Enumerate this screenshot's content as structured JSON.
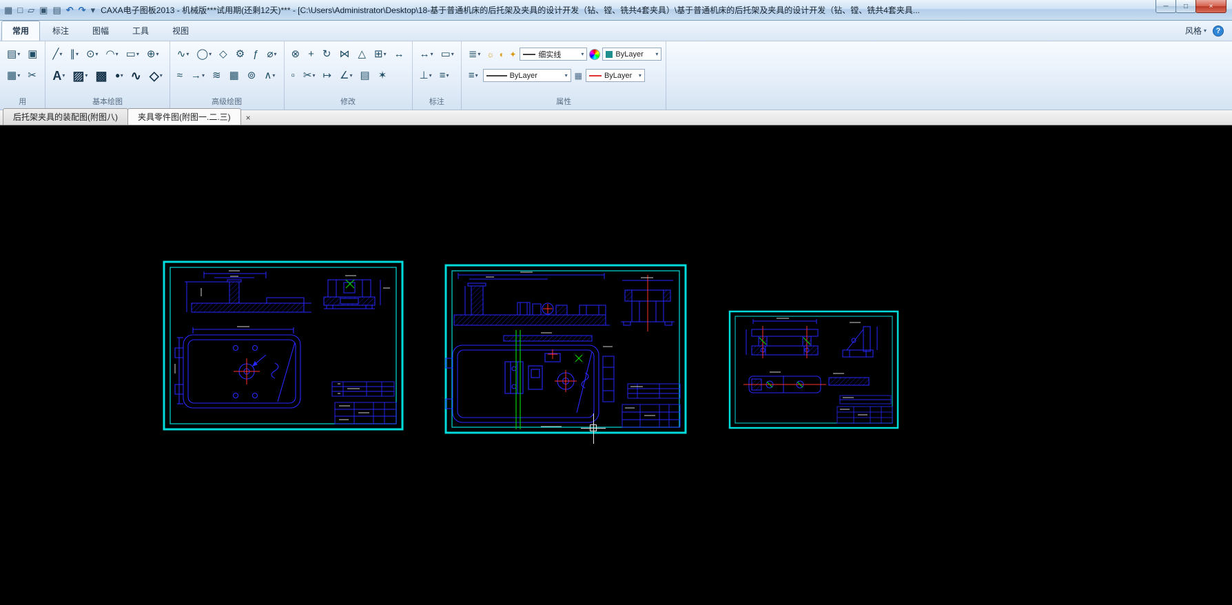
{
  "window": {
    "title": "CAXA电子图板2013 - 机械版***试用期(还剩12天)*** - [C:\\Users\\Administrator\\Desktop\\18-基于普通机床的后托架及夹具的设计开发（钻、镗、铣共4套夹具）\\基于普通机床的后托架及夹具的设计开发（钻、镗、铣共4套夹具...",
    "controls": [
      {
        "name": "minimize-button",
        "glyph": "─"
      },
      {
        "name": "maximize-button",
        "glyph": "□"
      },
      {
        "name": "close-button",
        "glyph": "×"
      }
    ]
  },
  "quick_access": [
    {
      "name": "app-icon",
      "glyph": "▦"
    },
    {
      "name": "new-file-icon",
      "glyph": "□"
    },
    {
      "name": "open-file-icon",
      "glyph": "▱"
    },
    {
      "name": "save-icon",
      "glyph": "▣"
    },
    {
      "name": "print-icon",
      "glyph": "▤"
    },
    {
      "name": "undo-icon",
      "glyph": "↶"
    },
    {
      "name": "redo-icon",
      "glyph": "↷"
    },
    {
      "name": "qat-dropdown-icon",
      "glyph": "▾"
    }
  ],
  "ribbon": {
    "tabs": [
      {
        "label": "常用",
        "active": true
      },
      {
        "label": "标注",
        "active": false
      },
      {
        "label": "图幅",
        "active": false
      },
      {
        "label": "工具",
        "active": false
      },
      {
        "label": "视图",
        "active": false
      }
    ],
    "style_button": "风格",
    "style_caret": "▾",
    "help_glyph": "?",
    "groups": {
      "clipboard": {
        "label": "用",
        "row1": [
          {
            "name": "paste-icon",
            "glyph": "▤",
            "caret": "▾"
          },
          {
            "name": "copy-icon",
            "glyph": "▣",
            "caret": ""
          }
        ],
        "row2": [
          {
            "name": "format-brush-icon",
            "glyph": "▦",
            "caret": "▾"
          },
          {
            "name": "cut-icon",
            "glyph": "✂",
            "caret": ""
          }
        ]
      },
      "basic": {
        "label": "基本绘图",
        "row1": [
          {
            "name": "line-icon",
            "glyph": "╱",
            "caret": "▾"
          },
          {
            "name": "parallel-line-icon",
            "glyph": "∥",
            "caret": "▾"
          },
          {
            "name": "circle-icon",
            "glyph": "⊙",
            "caret": "▾"
          },
          {
            "name": "arc-icon",
            "glyph": "◠",
            "caret": "▾"
          },
          {
            "name": "rectangle-icon",
            "glyph": "▭",
            "caret": "▾"
          },
          {
            "name": "centerline-icon",
            "glyph": "⊕",
            "caret": "▾"
          }
        ],
        "row2": [
          {
            "name": "text-icon",
            "glyph": "A",
            "caret": "▾"
          },
          {
            "name": "hatch-icon",
            "glyph": "▨",
            "caret": "▾"
          },
          {
            "name": "fill-icon",
            "glyph": "▩",
            "caret": ""
          },
          {
            "name": "point-icon",
            "glyph": "•",
            "caret": "▾"
          },
          {
            "name": "spline-icon",
            "glyph": "∿",
            "caret": ""
          },
          {
            "name": "block-icon",
            "glyph": "◇",
            "caret": "▾"
          }
        ]
      },
      "advanced": {
        "label": "高级绘图",
        "row1": [
          {
            "name": "curve-icon",
            "glyph": "∿",
            "caret": "▾"
          },
          {
            "name": "ellipse-icon",
            "glyph": "◯",
            "caret": "▾"
          },
          {
            "name": "polygon-icon",
            "glyph": "◇",
            "caret": ""
          },
          {
            "name": "gear-icon",
            "glyph": "⚙",
            "caret": ""
          },
          {
            "name": "formula-curve-icon",
            "glyph": "ƒ",
            "caret": ""
          },
          {
            "name": "hole-axis-icon",
            "glyph": "⌀",
            "caret": "▾"
          }
        ],
        "row2": [
          {
            "name": "wave-line-icon",
            "glyph": "≈",
            "caret": ""
          },
          {
            "name": "arrow-icon",
            "glyph": "→",
            "caret": "▾"
          },
          {
            "name": "double-fold-line-icon",
            "glyph": "≋",
            "caret": ""
          },
          {
            "name": "table-icon",
            "glyph": "▦",
            "caret": ""
          },
          {
            "name": "local-detail-icon",
            "glyph": "⊚",
            "caret": ""
          },
          {
            "name": "zigzag-icon",
            "glyph": "∧",
            "caret": "▾"
          }
        ]
      },
      "modify": {
        "label": "修改",
        "row1": [
          {
            "name": "erase-icon",
            "glyph": "⊗",
            "caret": ""
          },
          {
            "name": "move-icon",
            "glyph": "+",
            "caret": ""
          },
          {
            "name": "rotate-icon",
            "glyph": "↻",
            "caret": ""
          },
          {
            "name": "mirror-icon",
            "glyph": "⋈",
            "caret": ""
          },
          {
            "name": "scale-icon",
            "glyph": "△",
            "caret": ""
          },
          {
            "name": "array-icon",
            "glyph": "⊞",
            "caret": "▾"
          },
          {
            "name": "stretch-icon",
            "glyph": "↔",
            "caret": ""
          }
        ],
        "row2": [
          {
            "name": "pick-edit-icon",
            "glyph": "▫",
            "caret": ""
          },
          {
            "name": "trim-icon",
            "glyph": "✂",
            "caret": "▾"
          },
          {
            "name": "extend-icon",
            "glyph": "↦",
            "caret": ""
          },
          {
            "name": "chamfer-icon",
            "glyph": "∠",
            "caret": "▾"
          },
          {
            "name": "copy-object-icon",
            "glyph": "▤",
            "caret": ""
          },
          {
            "name": "explode-icon",
            "glyph": "✶",
            "caret": ""
          }
        ]
      },
      "dimension": {
        "label": "标注",
        "row1": [
          {
            "name": "dimension-icon",
            "glyph": "↔",
            "caret": "▾"
          },
          {
            "name": "dim-style-icon",
            "glyph": "▭",
            "caret": "▾"
          }
        ],
        "row2": [
          {
            "name": "coordinate-dim-icon",
            "glyph": "⊥",
            "caret": "▾"
          },
          {
            "name": "text-annotation-icon",
            "glyph": "≡",
            "caret": "▾"
          }
        ]
      },
      "properties": {
        "label": "属性",
        "layer_button": {
          "name": "layers-icon",
          "glyph": "≣",
          "caret": "▾"
        },
        "layer_tools": [
          {
            "name": "layer-on-icon",
            "glyph": "☼"
          },
          {
            "name": "layer-freeze-icon",
            "glyph": "◐"
          },
          {
            "name": "layer-lock-icon",
            "glyph": "✦"
          }
        ],
        "linetype_combo": {
          "value": "细实线",
          "caret": "▾"
        },
        "color_wheel": {
          "name": "color-wheel-icon"
        },
        "color_combo": {
          "value": "ByLayer",
          "caret": "▾",
          "swatch": "#1f8f8f"
        },
        "linewidth_button": {
          "name": "linewidth-icon",
          "glyph": "≡",
          "caret": "▾"
        },
        "linewidth_combo": {
          "value": "ByLayer",
          "caret": "▾",
          "line_color": "#404040"
        },
        "pattern_button": {
          "name": "pattern-icon",
          "glyph": "▦"
        },
        "linetype2_combo": {
          "value": "ByLayer",
          "caret": "▾",
          "line_color": "#e03030"
        }
      }
    }
  },
  "doc_tabs": [
    {
      "label": "后托架夹具的装配图(附图八)",
      "active": false
    },
    {
      "label": "夹具零件图(附图一.二.三)",
      "active": true
    }
  ],
  "doc_close_glyph": "×",
  "canvas": {
    "colors": {
      "background": "#000000",
      "sheet_frame": "#00dcdc",
      "drawing_line": "#2828ff",
      "centerline_red": "#ff3030",
      "highlight_green": "#00cc00",
      "dim_text": "#cfcfcf"
    },
    "sheets": [
      {
        "name": "sheet-1"
      },
      {
        "name": "sheet-2"
      },
      {
        "name": "sheet-3"
      }
    ]
  }
}
